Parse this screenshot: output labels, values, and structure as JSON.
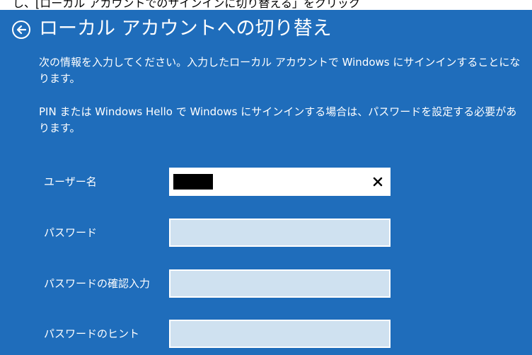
{
  "top_strip": {
    "text": "し、[ローカル アカウントでのサインインに切り替える」をクリック"
  },
  "header": {
    "title": "ローカル アカウントへの切り替え"
  },
  "body": {
    "paragraph1": "次の情報を入力してください。入力したローカル アカウントで Windows にサインインすることになります。",
    "paragraph2": "PIN または Windows Hello で Windows にサインインする場合は、パスワードを設定する必要があります。"
  },
  "form": {
    "fields": [
      {
        "label": "ユーザー名",
        "value": "[redacted]",
        "has_clear": true
      },
      {
        "label": "パスワード",
        "value": ""
      },
      {
        "label": "パスワードの確認入力",
        "value": ""
      },
      {
        "label": "パスワードのヒント",
        "value": ""
      }
    ]
  },
  "icons": {
    "back": "back-arrow-icon",
    "clear": "close-icon"
  },
  "colors": {
    "background": "#1f6dbb",
    "text": "#ffffff",
    "field_bg": "#cfe1f0",
    "field_active_bg": "#ffffff"
  }
}
